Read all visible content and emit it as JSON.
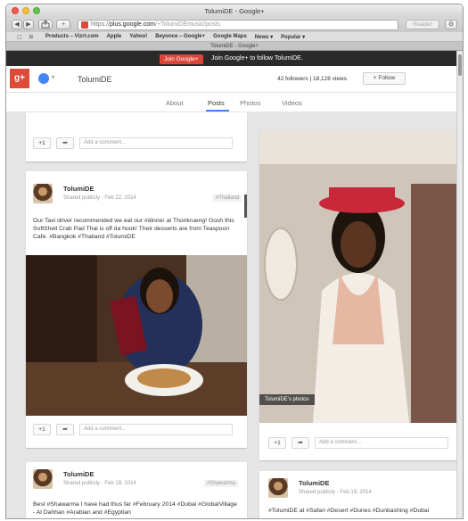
{
  "window": {
    "title": "TolumiDE - Google+",
    "url_prefix": "https://",
    "url_host": "plus.google.com",
    "url_path": "/+TolumiDEmusic/posts",
    "reader_label": "Reader",
    "nav_back": "◀",
    "nav_forward": "▶",
    "add_tab": "+",
    "settings_icon_glyph": "⚙"
  },
  "bookmarks": {
    "icons": "▢ ⊞",
    "items": [
      "Products – Vizrt.com",
      "Apple",
      "Yahoo!",
      "Beyonce – Google+",
      "Google Maps",
      "News ▾",
      "Popular ▾"
    ]
  },
  "tab_strip": {
    "label": "TolumiDE - Google+"
  },
  "banner": {
    "button_label": "Join Google+",
    "text": "Join Google+ to follow TolumiDE."
  },
  "header": {
    "logo_text": "g+",
    "profile_name": "TolumiDE",
    "followers": "42 followers",
    "separator": "|",
    "views": "18,128 views",
    "follow_label": "Follow"
  },
  "tabs": [
    "About",
    "Posts",
    "Photos",
    "Videos"
  ],
  "actions": {
    "plus_one": "+1",
    "share_glyph": "➦",
    "comment_placeholder": "Add a comment..."
  },
  "posts": [
    {
      "author": "TolumiDE",
      "visibility": "Shared publicly",
      "date": "Feb 22, 2014",
      "tag": "#Thailand",
      "text": "Our Taxi driver recommended we eat our #dinner at Thonkrueng! Gosh this SoftShell Crab Pad Thai is off da hook! Their desserts are from Teaspoon Cafe. #Bangkok #Thailand #TolumiDE"
    },
    {
      "author": "TolumiDE",
      "visibility": "Shared publicly",
      "date": "Feb 19, 2014",
      "tag": "#Shawarma",
      "text": "Best #Shawarma I have had thus far #February 2014 #Dubai #GlobalVillage - Al Dahhan #Arabian and #Egyptian"
    },
    {
      "author": "TolumiDE",
      "visibility": "Shared publicly",
      "date": "Feb 19, 2014",
      "text": "#TolumiDE  at #Safari #Desert #Dunes #Dunbashing #Dubai"
    }
  ],
  "photo_card": {
    "caption": "TolumiDE's photos"
  },
  "colors": {
    "gplus_red": "#dd4b39",
    "join_button": "#db4437",
    "banner_bg": "#2a2a2a",
    "tab_accent": "#4285f4",
    "stream_bg": "#e5e5e5"
  }
}
